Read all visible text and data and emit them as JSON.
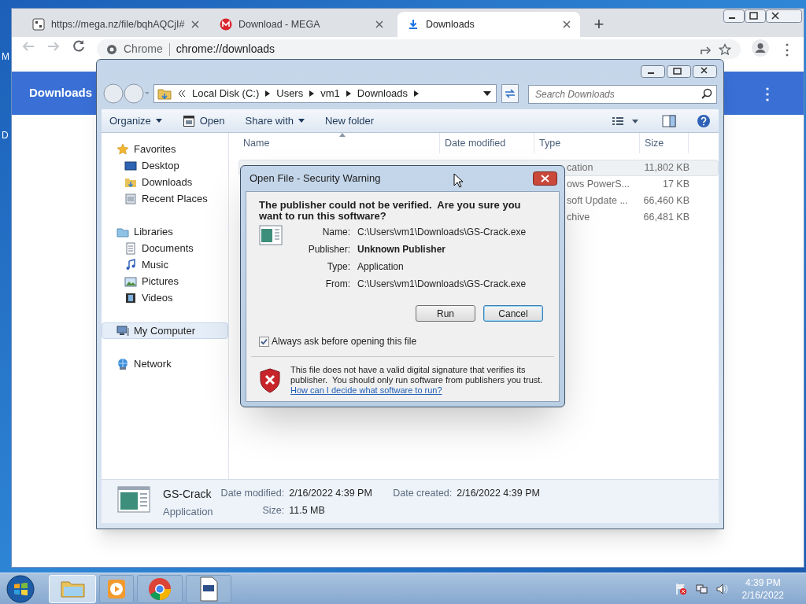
{
  "desktop": {
    "icon_labels": [
      "M",
      "D"
    ]
  },
  "browser": {
    "tabs": [
      {
        "title": "https://mega.nz/file/bqhAQCjI#",
        "kind": "file",
        "selected": false
      },
      {
        "title": "Download - MEGA",
        "kind": "mega",
        "selected": false
      },
      {
        "title": "Downloads",
        "kind": "download",
        "selected": true
      }
    ],
    "new_tab": "+",
    "chip": "Chrome",
    "url": "chrome://downloads",
    "page_title": "Downloads",
    "menu": "⋮"
  },
  "explorer": {
    "breadcrumb": [
      "Local Disk (C:)",
      "Users",
      "vm1",
      "Downloads"
    ],
    "search": {
      "placeholder": "Search Downloads"
    },
    "toolbar": [
      {
        "label": "Organize",
        "kind": "menu"
      },
      {
        "label": "Open",
        "kind": "open"
      },
      {
        "label": "Share with",
        "kind": "menu"
      },
      {
        "label": "New folder",
        "kind": "plain"
      }
    ],
    "nav": [
      {
        "label": "Favorites",
        "kind": "favorites",
        "selected": false,
        "children": [
          {
            "label": "Desktop",
            "kind": "desktop",
            "selected": false
          },
          {
            "label": "Downloads",
            "kind": "downloads",
            "selected": false
          },
          {
            "label": "Recent Places",
            "kind": "recent",
            "selected": false
          }
        ]
      },
      {
        "label": "Libraries",
        "kind": "libraries",
        "selected": false,
        "children": [
          {
            "label": "Documents",
            "kind": "documents",
            "selected": false
          },
          {
            "label": "Music",
            "kind": "music",
            "selected": false
          },
          {
            "label": "Pictures",
            "kind": "pictures",
            "selected": false
          },
          {
            "label": "Videos",
            "kind": "videos",
            "selected": false
          }
        ]
      },
      {
        "label": "My Computer",
        "kind": "computer",
        "selected": true
      },
      {
        "label": "Network",
        "kind": "network",
        "selected": false
      }
    ],
    "columns": [
      "Name",
      "Date modified",
      "Type",
      "Size"
    ],
    "rows": [
      {
        "type": "cation",
        "size": "11,802 KB",
        "selected": true
      },
      {
        "type": "ows PowerS...",
        "size": "17 KB",
        "selected": false
      },
      {
        "type": "soft Update ...",
        "size": "66,460 KB",
        "selected": false
      },
      {
        "type": "chive",
        "size": "66,481 KB",
        "selected": false
      }
    ],
    "details": {
      "name": "GS-Crack",
      "type": "Application",
      "fields": [
        {
          "label": "Date modified:",
          "value": "2/16/2022 4:39 PM"
        },
        {
          "label": "Size:",
          "value": "11.5 MB"
        },
        {
          "label": "Date created:",
          "value": "2/16/2022 4:39 PM"
        }
      ]
    }
  },
  "dialog": {
    "title": "Open File - Security Warning",
    "heading": "The publisher could not be verified.  Are you sure you want to run this software?",
    "fields": [
      {
        "label": "Name:",
        "value": "C:\\Users\\vm1\\Downloads\\GS-Crack.exe",
        "emphasis": false
      },
      {
        "label": "Publisher:",
        "value": "Unknown Publisher",
        "emphasis": true
      },
      {
        "label": "Type:",
        "value": "Application",
        "emphasis": false
      },
      {
        "label": "From:",
        "value": "C:\\Users\\vm1\\Downloads\\GS-Crack.exe",
        "emphasis": false
      }
    ],
    "buttons": [
      {
        "label": "Run",
        "default": false
      },
      {
        "label": "Cancel",
        "default": true
      }
    ],
    "checkbox": {
      "label": "Always ask before opening this file",
      "checked": true
    },
    "warning": "This file does not have a valid digital signature that verifies its publisher.  You should only run software from publishers you trust.",
    "link": "How can I decide what software to run?"
  },
  "taskbar": {
    "apps": [
      {
        "kind": "explorer",
        "active": true
      },
      {
        "kind": "media",
        "active": false
      },
      {
        "kind": "chrome",
        "active": false
      },
      {
        "kind": "document",
        "active": false
      }
    ],
    "time": "4:39 PM",
    "date": "2/16/2022"
  }
}
